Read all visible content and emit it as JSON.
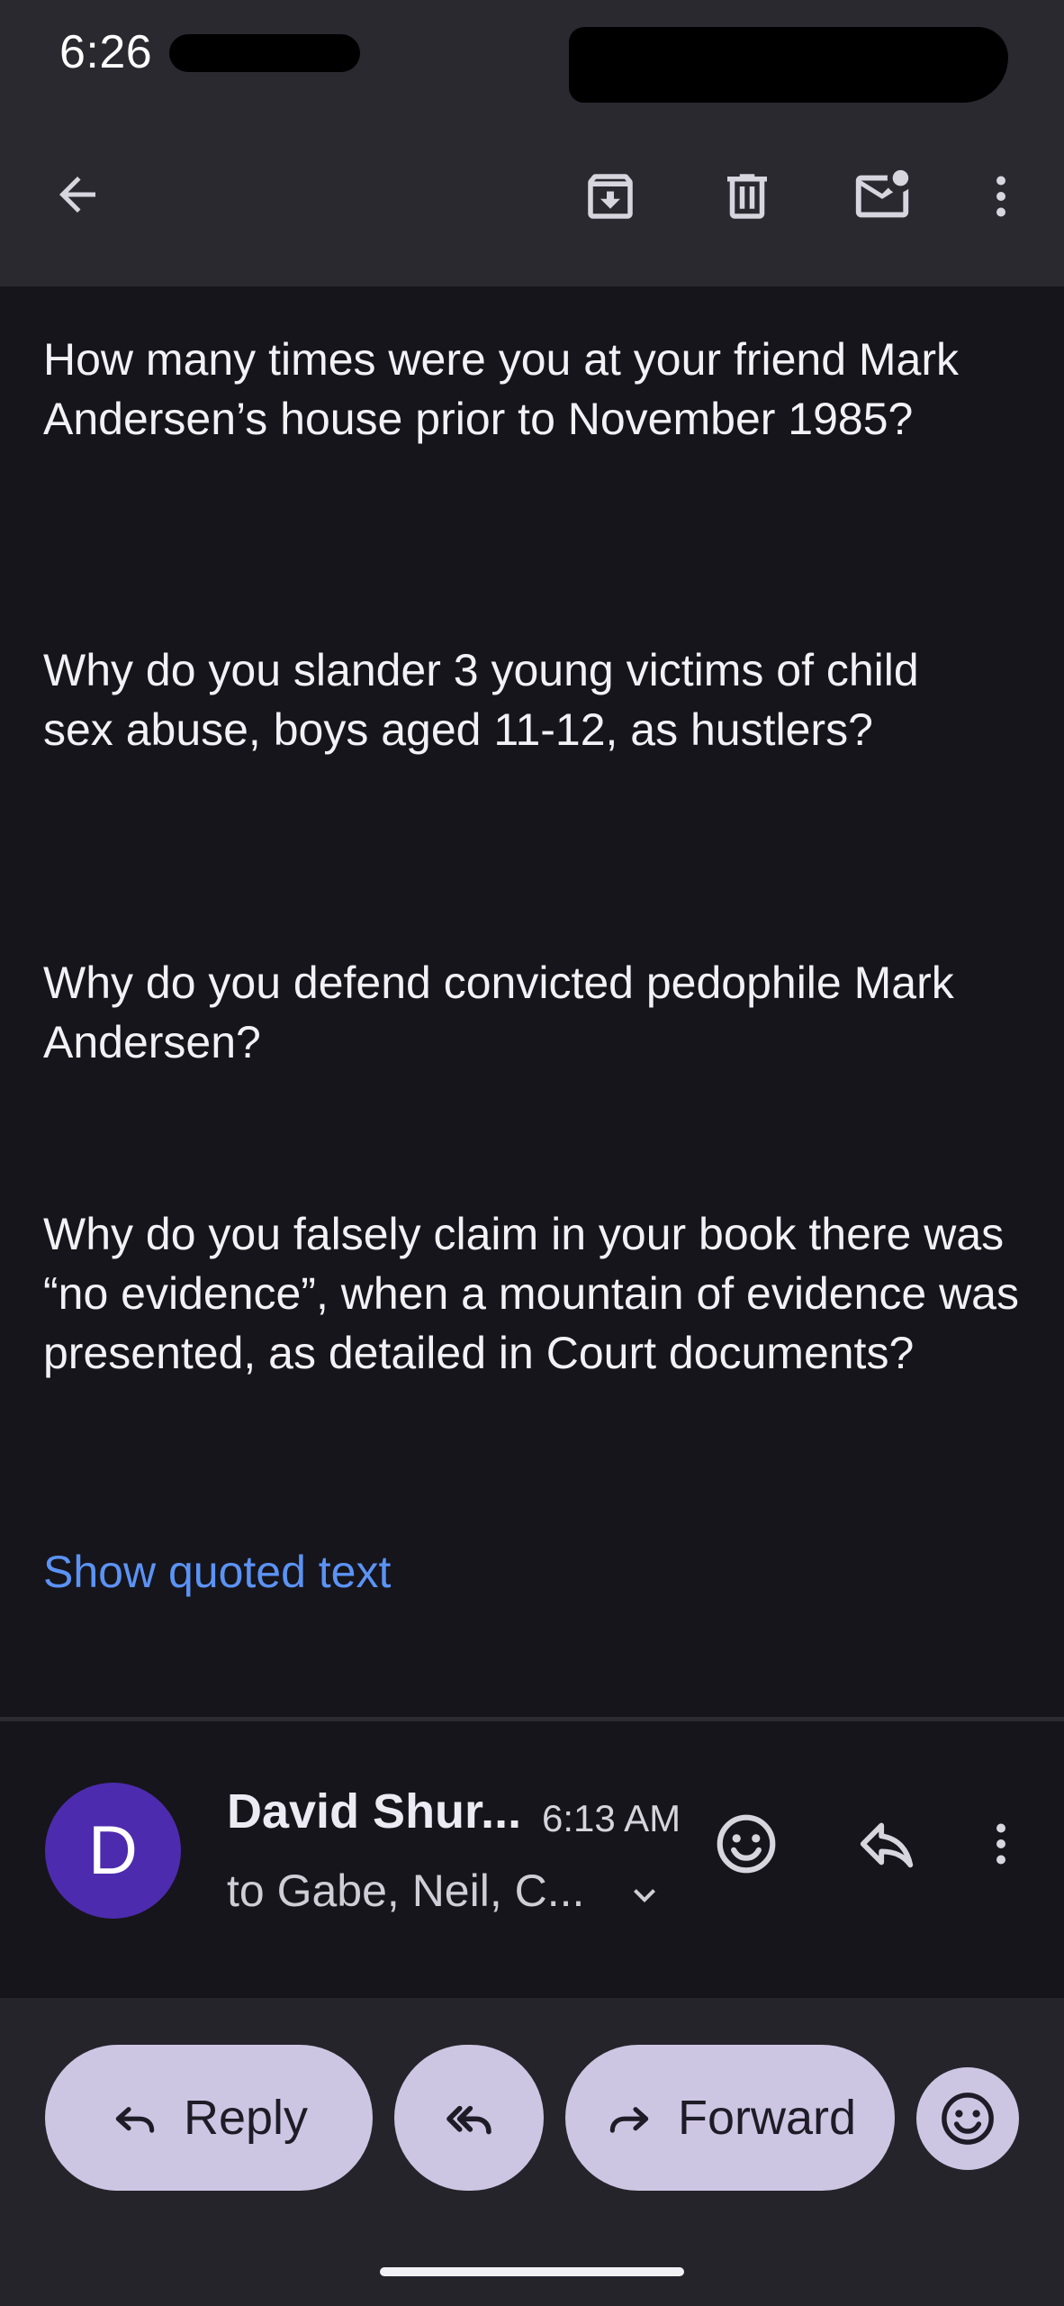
{
  "status_bar": {
    "time": "6:26"
  },
  "toolbar": {
    "back_icon": "arrow-back-icon",
    "archive_icon": "archive-icon",
    "delete_icon": "trash-icon",
    "mark_unread_icon": "mark-unread-icon",
    "more_icon": "more-vert-icon"
  },
  "email_body": {
    "paragraphs": [
      "How many times were you at your friend Mark Andersen’s house prior to November 1985?",
      "Why do you slander 3 young victims of child sex abuse, boys aged 11-12, as hustlers?",
      "Why do you defend convicted pedophile Mark Andersen?",
      "Why do you falsely claim in your book there was “no evidence”, when a mountain of evidence was presented, as detailed in Court documents?"
    ],
    "show_quoted_text": "Show quoted text"
  },
  "message": {
    "avatar_letter": "D",
    "avatar_color": "#4d2bae",
    "sender": "David Shur...",
    "time": "6:13 AM",
    "recipients": "to Gabe, Neil, C..."
  },
  "actions": {
    "reply": "Reply",
    "forward": "Forward"
  },
  "colors": {
    "link": "#5b93f5",
    "pill": "#cdc6e3",
    "background": "#16151b"
  }
}
